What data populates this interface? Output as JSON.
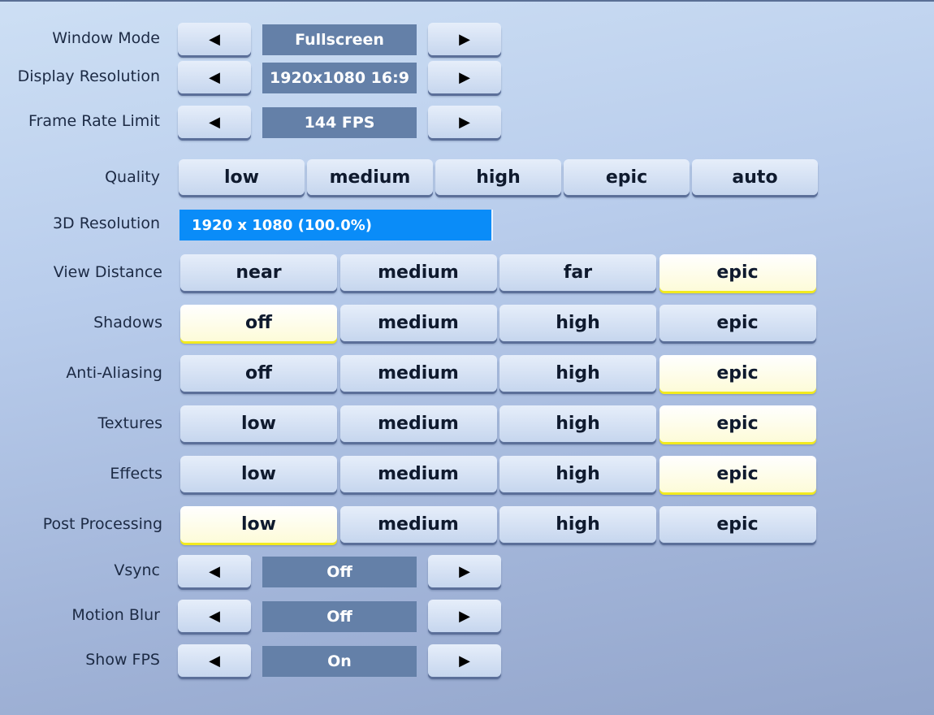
{
  "steppers": [
    {
      "id": "window-mode",
      "label": "Window Mode",
      "value": "Fullscreen"
    },
    {
      "id": "display-resolution",
      "label": "Display Resolution",
      "value": "1920x1080 16:9"
    },
    {
      "id": "frame-rate-limit",
      "label": "Frame Rate Limit",
      "value": "144 FPS"
    }
  ],
  "arrows": {
    "left": "◀",
    "right": "▶",
    "left_icon": "arrow-left-icon",
    "right_icon": "arrow-right-icon"
  },
  "quality": {
    "label": "Quality",
    "options": [
      "low",
      "medium",
      "high",
      "epic",
      "auto"
    ]
  },
  "resolution_3d": {
    "label": "3D Resolution",
    "value": "1920 x 1080 (100.0%)",
    "percent": 100,
    "color": "#0a8cf8"
  },
  "grid": [
    {
      "id": "view-distance",
      "label": "View Distance",
      "options": [
        "near",
        "medium",
        "far",
        "epic"
      ],
      "selected": 3
    },
    {
      "id": "shadows",
      "label": "Shadows",
      "options": [
        "off",
        "medium",
        "high",
        "epic"
      ],
      "selected": 0
    },
    {
      "id": "anti-aliasing",
      "label": "Anti-Aliasing",
      "options": [
        "off",
        "medium",
        "high",
        "epic"
      ],
      "selected": 3
    },
    {
      "id": "textures",
      "label": "Textures",
      "options": [
        "low",
        "medium",
        "high",
        "epic"
      ],
      "selected": 3
    },
    {
      "id": "effects",
      "label": "Effects",
      "options": [
        "low",
        "medium",
        "high",
        "epic"
      ],
      "selected": 3
    },
    {
      "id": "post-processing",
      "label": "Post Processing",
      "options": [
        "low",
        "medium",
        "high",
        "epic"
      ],
      "selected": 0
    }
  ],
  "bottom_steppers": [
    {
      "id": "vsync",
      "label": "Vsync",
      "value": "Off"
    },
    {
      "id": "motion-blur",
      "label": "Motion Blur",
      "value": "Off"
    },
    {
      "id": "show-fps",
      "label": "Show FPS",
      "value": "On"
    }
  ],
  "colors": {
    "selected": "#fdfbd8",
    "selected_underline": "#f2ea1e",
    "value_box": "#6480a8"
  }
}
